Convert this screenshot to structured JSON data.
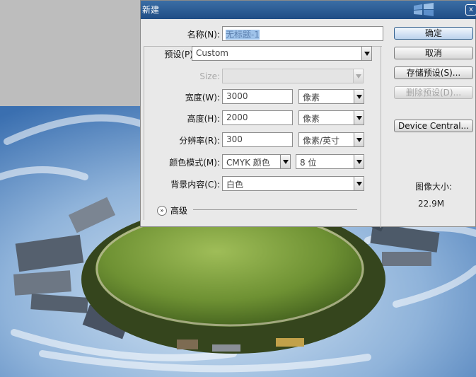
{
  "dialog": {
    "title": "新建",
    "close_glyph": "x"
  },
  "form": {
    "name_label": "名称(N):",
    "name_value": "无标题-1",
    "preset_label": "预设(P):",
    "preset_value": "Custom",
    "size_label": "Size:",
    "size_value": "",
    "width_label": "宽度(W):",
    "width_value": "3000",
    "width_unit": "像素",
    "height_label": "高度(H):",
    "height_value": "2000",
    "height_unit": "像素",
    "resolution_label": "分辨率(R):",
    "resolution_value": "300",
    "resolution_unit": "像素/英寸",
    "color_mode_label": "颜色模式(M):",
    "color_mode_value": "CMYK 颜色",
    "bit_depth_value": "8 位",
    "background_label": "背景内容(C):",
    "background_value": "白色",
    "advanced_label": "高级",
    "advanced_toggle_glyph": "»"
  },
  "buttons": {
    "ok": "确定",
    "cancel": "取消",
    "save_preset": "存储预设(S)...",
    "delete_preset": "删除预设(D)...",
    "device_central": "Device Central..."
  },
  "image_size": {
    "label": "图像大小:",
    "value": "22.9M"
  },
  "colors": {
    "titlebar": "#2b5c96",
    "dialog_bg": "#e9e9e9",
    "selection": "#9fc3ea"
  }
}
